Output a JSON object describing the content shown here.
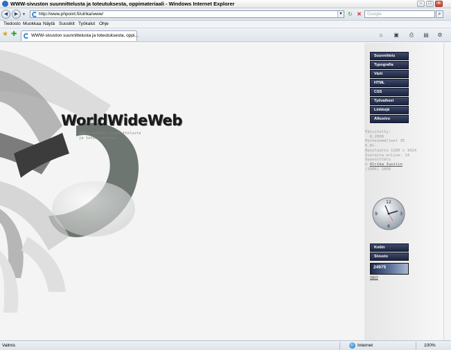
{
  "window": {
    "title": "WWW-sivuston suunnittelusta ja toteutuksesta, oppimateriaali - Windows Internet Explorer"
  },
  "address": {
    "url": "http://www.phpoint.fi/ulrika/www/",
    "search_placeholder": "Google"
  },
  "menu": [
    "Tiedosto",
    "Muokkaa",
    "Näytä",
    "Suosikit",
    "Työkalut",
    "Ohje"
  ],
  "tab": {
    "label": "WWW-sivuston suunnittelusta ja toteutuksesta, oppi..."
  },
  "page": {
    "logo_title": "WorldWideWeb",
    "subtitle_line1": "WWW-sivuston suunnittelusta",
    "subtitle_line2": "ja toteutuksesta",
    "nav": [
      "Suunnittelu",
      "Typografia",
      "Värit",
      "HTML",
      "CSS",
      "Työvaiheet",
      "Linkkejä",
      "Alkusivu"
    ],
    "info": {
      "line1": "Päivitetty:",
      "line2": "  6.2008",
      "line3": "Perheimmälleet IE",
      "line4": "6.0+",
      "line5": "Resoluutio 1280 x 1024",
      "line6": "Vieraita online: 14",
      "line7": "Suunnittelu",
      "author": "Ulrika Jusslin",
      "line9": "(2006) 2008"
    },
    "clock_numbers": [
      "12",
      "3",
      "6",
      "9"
    ],
    "bottom_buttons": [
      "Kotiin",
      "Sivusto"
    ],
    "counter": "24975",
    "seo": "SEO"
  },
  "status": {
    "text": "Valmis",
    "zone": "Internet",
    "zoom": "100%"
  },
  "icons": {
    "back": "back-arrow-icon",
    "forward": "forward-arrow-icon",
    "refresh": "refresh-icon",
    "stop": "stop-icon",
    "search": "search-icon",
    "favorites": "favorites-star-icon",
    "add_favorite": "add-favorite-icon",
    "home": "home-icon",
    "feeds": "feeds-icon",
    "print": "print-icon",
    "page": "page-menu-icon",
    "tools": "tools-menu-icon"
  },
  "colors": {
    "nav_button": "#2a3456",
    "stop_red": "#d4232a",
    "refresh_green": "#3a9b2e"
  }
}
